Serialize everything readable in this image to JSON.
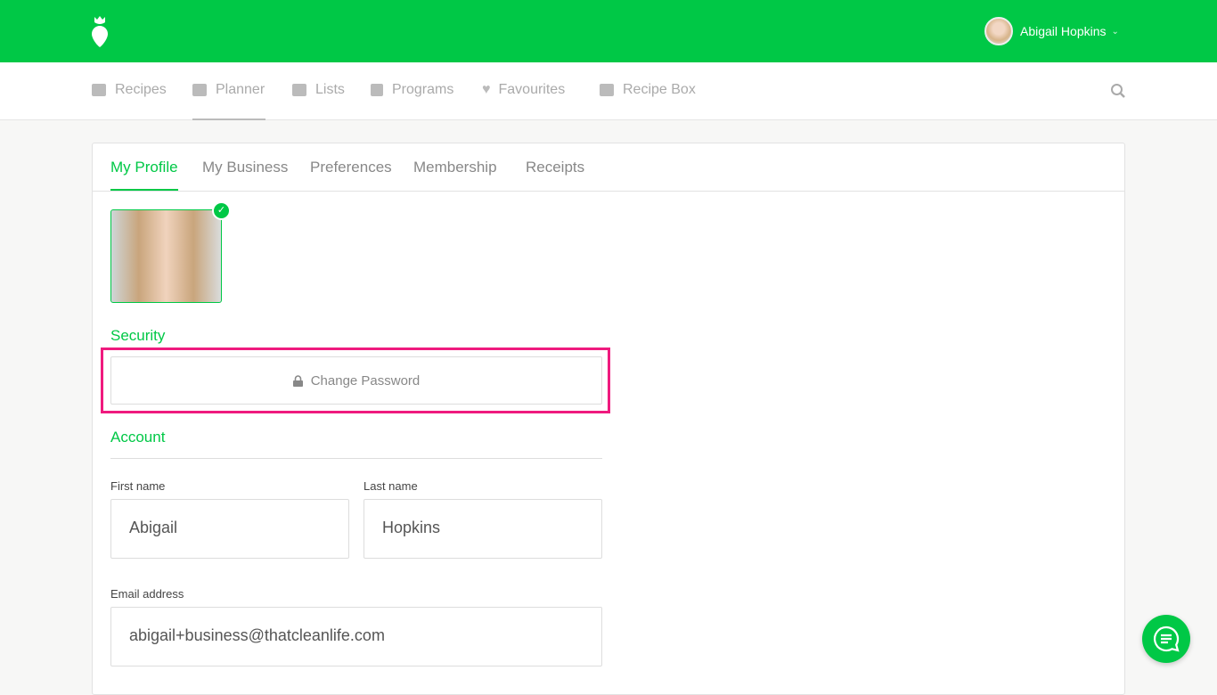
{
  "header": {
    "user_name": "Abigail Hopkins"
  },
  "nav": {
    "items": [
      {
        "label": "Recipes"
      },
      {
        "label": "Planner"
      },
      {
        "label": "Lists"
      },
      {
        "label": "Programs"
      },
      {
        "label": "Favourites"
      },
      {
        "label": "Recipe Box"
      }
    ]
  },
  "tabs": [
    {
      "label": "My Profile"
    },
    {
      "label": "My Business"
    },
    {
      "label": "Preferences"
    },
    {
      "label": "Membership"
    },
    {
      "label": "Receipts"
    }
  ],
  "security": {
    "heading": "Security",
    "change_password": "Change Password"
  },
  "account": {
    "heading": "Account",
    "first_name_label": "First name",
    "first_name": "Abigail",
    "last_name_label": "Last name",
    "last_name": "Hopkins",
    "email_label": "Email address",
    "email": "abigail+business@thatcleanlife.com"
  },
  "colors": {
    "brand": "#00c846",
    "highlight": "#ef1a7e"
  }
}
